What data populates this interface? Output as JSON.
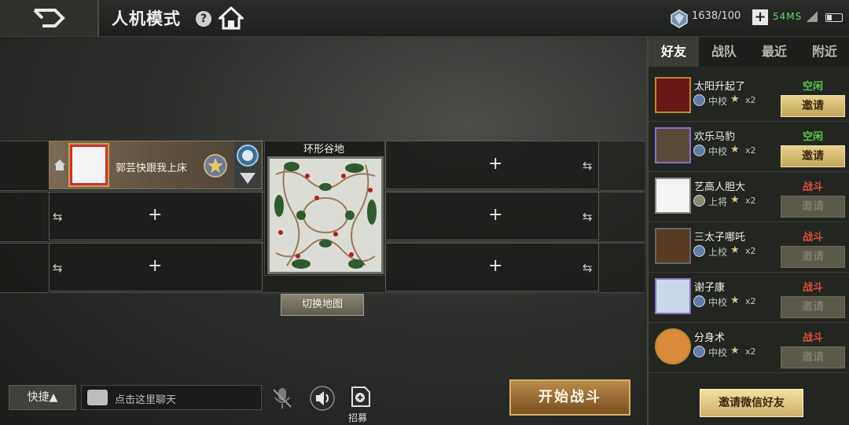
{
  "header": {
    "back_label": "",
    "title": "人机模式",
    "help": "?",
    "currency": "1638/100",
    "plus": "+",
    "ping": "54MS"
  },
  "lobby": {
    "player_name": "郭芸快跟我上床",
    "map_name": "环形谷地",
    "switch_map_label": "切换地图",
    "add_symbol": "+",
    "swap_symbol": "⇆"
  },
  "bottom": {
    "shortcut_label": "快捷▲",
    "chat_placeholder": "点击这里聊天",
    "recruit_label": "招募",
    "start_label": "开始战斗"
  },
  "panel": {
    "tabs": [
      "好友",
      "战队",
      "最近",
      "附近"
    ],
    "friends": [
      {
        "name": "太阳升起了",
        "rank": "中校",
        "stars": "x2",
        "status": "空闲",
        "status_color": "#58c84b",
        "invite": "邀请"
      },
      {
        "name": "欢乐马豹",
        "rank": "中校",
        "stars": "x2",
        "status": "空闲",
        "status_color": "#58c84b",
        "invite": "邀请"
      },
      {
        "name": "艺高人胆大",
        "rank": "上将",
        "stars": "x2",
        "status": "战斗",
        "status_color": "#e0503a",
        "invite": "邀请"
      },
      {
        "name": "三太子哪吒",
        "rank": "上校",
        "stars": "x2",
        "status": "战斗",
        "status_color": "#e0503a",
        "invite": "邀请"
      },
      {
        "name": "谢子康",
        "rank": "中校",
        "stars": "x2",
        "status": "战斗",
        "status_color": "#e0503a",
        "invite": "邀请"
      },
      {
        "name": "分身术",
        "rank": "中校",
        "stars": "x2",
        "status": "战斗",
        "status_color": "#e0503a",
        "invite": "邀请"
      }
    ],
    "wechat_label": "邀请微信好友"
  },
  "colors": {
    "accent_gold": "#c2a65a",
    "idle_green": "#58c84b",
    "battle_red": "#e0503a",
    "ping_green": "#6fd06f"
  }
}
